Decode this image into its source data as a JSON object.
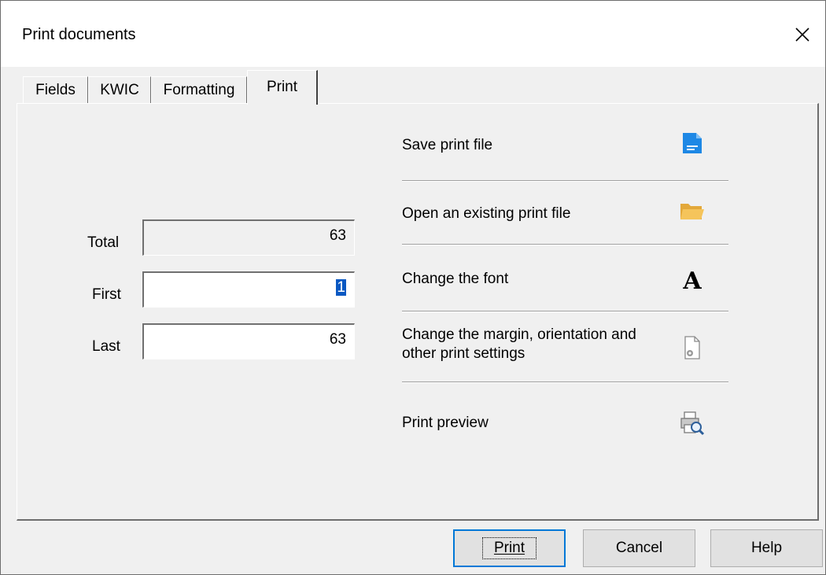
{
  "window": {
    "title": "Print documents"
  },
  "tabs": [
    {
      "label": "Fields"
    },
    {
      "label": "KWIC"
    },
    {
      "label": "Formatting"
    },
    {
      "label": "Print",
      "active": true
    }
  ],
  "range": {
    "total_label": "Total",
    "total_value": "63",
    "first_label": "First",
    "first_value": "1",
    "last_label": "Last",
    "last_value": "63"
  },
  "actions": [
    {
      "label": "Save print file",
      "icon": "save-file-icon"
    },
    {
      "label": "Open an existing print file",
      "icon": "folder-icon"
    },
    {
      "label": "Change the font",
      "icon": "font-icon"
    },
    {
      "label": "Change the margin, orientation and other print settings",
      "icon": "page-settings-icon"
    },
    {
      "label": "Print preview",
      "icon": "print-preview-icon"
    }
  ],
  "buttons": {
    "print": "Print",
    "cancel": "Cancel",
    "help": "Help"
  },
  "colors": {
    "accent": "#0078d7",
    "selection": "#0a58c2",
    "save_icon": "#1e88e5",
    "folder_icon": "#f5c45b"
  }
}
